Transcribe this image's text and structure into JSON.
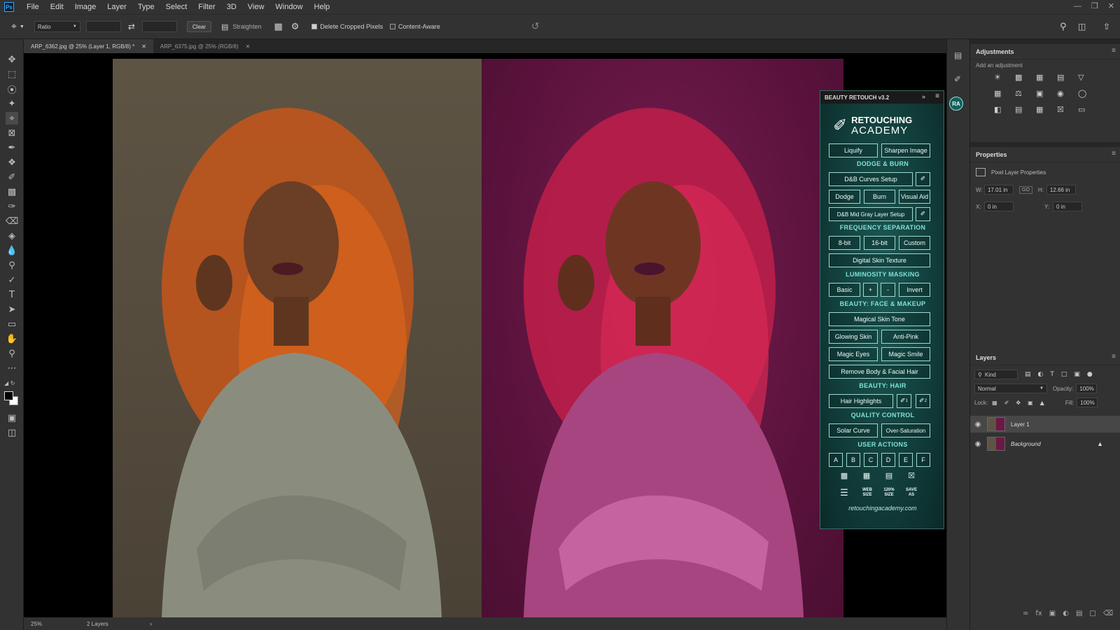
{
  "menubar": {
    "logo": "Ps",
    "items": [
      "File",
      "Edit",
      "Image",
      "Layer",
      "Type",
      "Select",
      "Filter",
      "3D",
      "View",
      "Window",
      "Help"
    ]
  },
  "options": {
    "ratio_label": "Ratio",
    "clear_label": "Clear",
    "straighten_label": "Straighten",
    "delete_cropped_label": "Delete Cropped Pixels",
    "content_aware_label": "Content-Aware"
  },
  "tabs": [
    {
      "label": "ARP_6362.jpg @ 25% (Layer 1, RGB/8) *"
    },
    {
      "label": "ARP_6375.jpg @ 25% (RGB/8)"
    }
  ],
  "status": {
    "zoom": "25%",
    "info": "2 Layers"
  },
  "mini_strip": {
    "ra_badge": "RA"
  },
  "adjustments": {
    "title": "Adjustments",
    "subtitle": "Add an adjustment"
  },
  "properties": {
    "title": "Properties",
    "subtitle": "Pixel Layer Properties",
    "w_label": "W:",
    "w_value": "17.01 in",
    "link_label": "GO",
    "h_label": "H:",
    "h_value": "12.66 in",
    "x_label": "X:",
    "x_value": "0 in",
    "y_label": "Y:",
    "y_value": "0 in"
  },
  "layers_panel": {
    "title": "Layers",
    "filter": "Kind",
    "blend_mode": "Normal",
    "opacity_label": "Opacity:",
    "opacity_value": "100%",
    "lock_label": "Lock:",
    "fill_label": "Fill:",
    "fill_value": "100%",
    "layers": [
      {
        "name": "Layer 1",
        "selected": true
      },
      {
        "name": "Background",
        "selected": false
      }
    ]
  },
  "beauty_retouch": {
    "title": "BEAUTY RETOUCH v3.2",
    "logo_line1": "RETOUCHING",
    "logo_line2": "ACADEMY",
    "liquify": "Liquify",
    "sharpen": "Sharpen Image",
    "dodge_burn_head": "DODGE & BURN",
    "db_curves": "D&B Curves Setup",
    "dodge": "Dodge",
    "burn": "Burn",
    "visual_aid": "Visual Aid",
    "db_midgray": "D&B Mid Gray Layer Setup",
    "freq_head": "FREQUENCY SEPARATION",
    "bit8": "8-bit",
    "bit16": "16-bit",
    "custom": "Custom",
    "digital_skin": "Digital Skin Texture",
    "lum_head": "LUMINOSITY MASKING",
    "basic": "Basic",
    "plus": "+",
    "minus": "-",
    "invert": "Invert",
    "face_head": "BEAUTY: FACE & MAKEUP",
    "magical_skin": "Magical Skin Tone",
    "glowing_skin": "Glowing Skin",
    "anti_pink": "Anti-Pink",
    "magic_eyes": "Magic Eyes",
    "magic_smile": "Magic Smile",
    "remove_hair": "Remove Body & Facial Hair",
    "hair_head": "BEAUTY: HAIR",
    "hair_highlights": "Hair Highlights",
    "brush1": "1",
    "brush2": "2",
    "qc_head": "QUALITY CONTROL",
    "solar_curve": "Solar Curve",
    "over_saturation": "Over-Saturation",
    "user_head": "USER ACTIONS",
    "user_actions": [
      "A",
      "B",
      "C",
      "D",
      "E",
      "F"
    ],
    "web_size": "WEB SIZE",
    "size120": "120% SIZE",
    "save_as": "SAVE AS",
    "url": "retouchingacademy.com"
  }
}
